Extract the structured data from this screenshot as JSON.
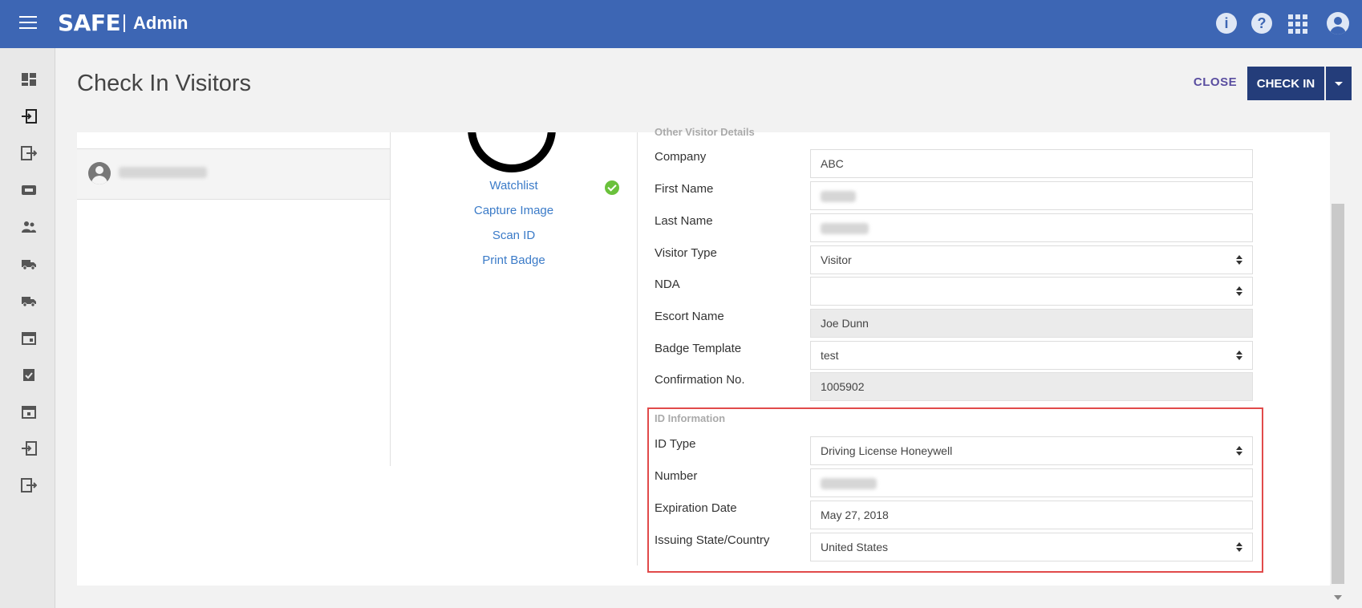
{
  "header": {
    "brand": "SAFE",
    "app": "Admin"
  },
  "page": {
    "title": "Check In Visitors"
  },
  "actions": {
    "close": "CLOSE",
    "checkin": "CHECK IN"
  },
  "mid": {
    "watchlist": "Watchlist",
    "capture": "Capture Image",
    "scan": "Scan ID",
    "print": "Print Badge"
  },
  "details": {
    "section": "Other Visitor Details",
    "company_label": "Company",
    "company": "ABC",
    "first_label": "First Name",
    "last_label": "Last Name",
    "type_label": "Visitor Type",
    "type": "Visitor",
    "nda_label": "NDA",
    "nda": "",
    "escort_label": "Escort Name",
    "escort": "Joe Dunn",
    "badge_label": "Badge Template",
    "badge": "test",
    "conf_label": "Confirmation No.",
    "conf": "1005902"
  },
  "id_info": {
    "section": "ID Information",
    "type_label": "ID Type",
    "type": "Driving License Honeywell",
    "number_label": "Number",
    "exp_label": "Expiration Date",
    "exp": "May 27, 2018",
    "state_label": "Issuing State/Country",
    "state": "United States"
  },
  "colors": {
    "header": "#3d66b4",
    "primary_button": "#243d7a",
    "link": "#3b7bc8",
    "highlight": "#e14a4a",
    "ok": "#6ac13b"
  }
}
